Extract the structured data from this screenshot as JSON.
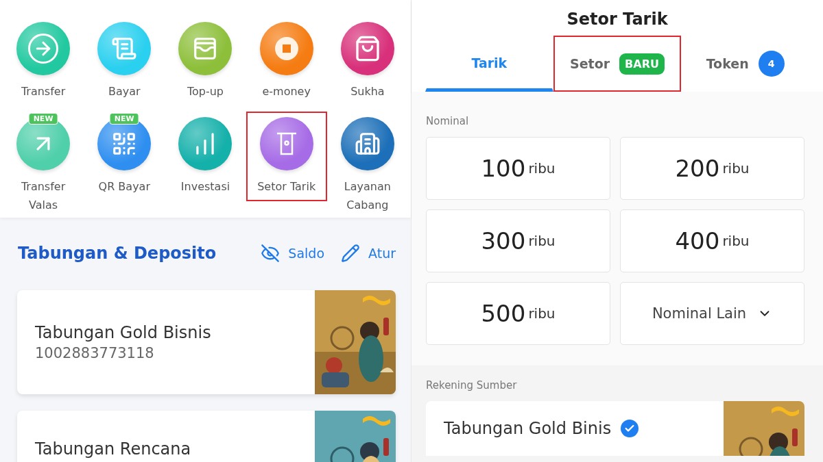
{
  "menu": {
    "items": [
      {
        "label": "Transfer",
        "color": "#22c9a0",
        "highlighted": false
      },
      {
        "label": "Bayar",
        "color": "#2ad0ef",
        "highlighted": false
      },
      {
        "label": "Top-up",
        "color": "#8dbf3a",
        "highlighted": false
      },
      {
        "label": "e-money",
        "color": "#f57c12",
        "highlighted": false
      },
      {
        "label": "Sukha",
        "color": "#d8307a",
        "highlighted": false
      },
      {
        "label": "Transfer Valas",
        "color": "#4fcfaa",
        "badge": "NEW",
        "highlighted": false
      },
      {
        "label": "QR Bayar",
        "color": "#2f8ff0",
        "badge": "NEW",
        "highlighted": false
      },
      {
        "label": "Investasi",
        "color": "#14b0aa",
        "highlighted": false
      },
      {
        "label": "Setor Tarik",
        "color": "#a66be6",
        "highlighted": true
      },
      {
        "label": "Layanan Cabang",
        "color": "#1c6fb8",
        "highlighted": false
      }
    ]
  },
  "savings": {
    "title": "Tabungan & Deposito",
    "actions": [
      "Saldo",
      "Atur"
    ],
    "accounts": [
      {
        "name": "Tabungan Gold Bisnis",
        "number": "1002883773118"
      },
      {
        "name": "Tabungan Rencana"
      }
    ]
  },
  "withdraw": {
    "title": "Setor Tarik",
    "tabs": [
      {
        "label": "Tarik",
        "selected": true,
        "highlighted": false
      },
      {
        "label": "Setor",
        "selected": false,
        "badge": "BARU",
        "highlighted": true
      },
      {
        "label": "Token",
        "selected": false,
        "count": "4",
        "highlighted": false
      }
    ],
    "nominal_label": "Nominal",
    "amounts": [
      {
        "kind": "amount",
        "value": "100",
        "unit": "ribu"
      },
      {
        "kind": "amount",
        "value": "200",
        "unit": "ribu"
      },
      {
        "kind": "amount",
        "value": "300",
        "unit": "ribu"
      },
      {
        "kind": "amount",
        "value": "400",
        "unit": "ribu"
      },
      {
        "kind": "amount",
        "value": "500",
        "unit": "ribu"
      },
      {
        "kind": "dropdown",
        "value": "Nominal Lain"
      }
    ],
    "source_label": "Rekening Sumber",
    "source_account": {
      "name": "Tabungan Gold Binis",
      "checked": true
    }
  }
}
